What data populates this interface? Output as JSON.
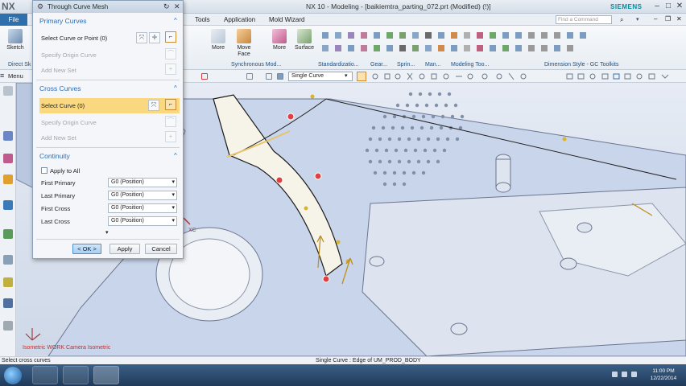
{
  "window": {
    "app_logo": "NX",
    "title": "NX 10 - Modeling - [baikiemtra_parting_072.prt (Modified)   (!)]",
    "brand": "SIEMENS",
    "controls": [
      "–",
      "□",
      "✕"
    ]
  },
  "menubar": {
    "file_label": "File",
    "tabs": [
      "Tools",
      "Application",
      "Mold Wizard"
    ],
    "find_placeholder": "Find a Command"
  },
  "ribbon": {
    "sketch_label": "Sketch",
    "direct_sketch_label": "Direct Sk",
    "more_label_1": "More",
    "move_face_label": "Move\nFace",
    "more_label_2": "More",
    "surface_label": "Surface",
    "groups": [
      "Synchronous Mod...",
      "Standardizatio...",
      "Gear...",
      "Sprin...",
      "Man...",
      "Modeling Too...",
      "Dimension Style - GC Toolkits"
    ]
  },
  "cmdbar": {
    "menu_label": "Menu",
    "curve_rule": "Single Curve"
  },
  "dialog": {
    "title": "Through Curve Mesh",
    "primary": {
      "heading": "Primary Curves",
      "select_label": "Select Curve or Point (0)",
      "origin_label": "Specify Origin Curve",
      "add_label": "Add New Set"
    },
    "cross": {
      "heading": "Cross Curves",
      "select_label": "Select Curve (0)",
      "origin_label": "Specify Origin Curve",
      "add_label": "Add New Set"
    },
    "continuity": {
      "heading": "Continuity",
      "apply_all_label": "Apply to All",
      "rows": [
        {
          "label": "First Primary",
          "value": "G0 (Position)"
        },
        {
          "label": "Last Primary",
          "value": "G0 (Position)"
        },
        {
          "label": "First Cross",
          "value": "G0 (Position)"
        },
        {
          "label": "Last Cross",
          "value": "G0 (Position)"
        }
      ]
    },
    "buttons": {
      "ok": "< OK >",
      "apply": "Apply",
      "cancel": "Cancel"
    }
  },
  "viewport": {
    "triad_axis": "XC",
    "view_label": "Isometric WORK Camera Isometric"
  },
  "status": {
    "left": "Select cross curves",
    "middle": "Single Curve : Edge of UM_PROD_BODY"
  },
  "taskbar": {
    "time": "11:00 PM",
    "date": "12/22/2014"
  },
  "colors": {
    "accent_blue": "#2e6fae",
    "selection_yellow": "#fad880",
    "section_heading": "#2a6ebb"
  }
}
